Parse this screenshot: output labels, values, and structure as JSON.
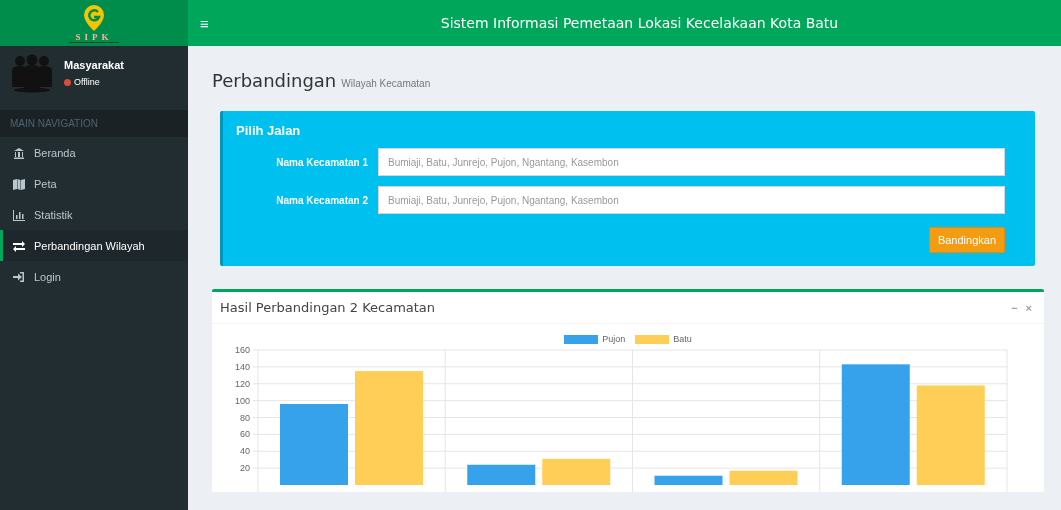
{
  "header": {
    "logo_text": "SIPK",
    "menu_icon": "≡",
    "app_title": "Sistem Informasi Pemetaan Lokasi Kecelakaan Kota Batu"
  },
  "sidebar": {
    "user": {
      "name": "Masyarakat",
      "status": "Offline",
      "online": false
    },
    "section_label": "MAIN NAVIGATION",
    "items": [
      {
        "label": "Beranda",
        "selected": false
      },
      {
        "label": "Peta",
        "selected": false
      },
      {
        "label": "Statistik",
        "selected": false
      },
      {
        "label": "Perbandingan Wilayah",
        "selected": true
      },
      {
        "label": "Login",
        "selected": false
      }
    ]
  },
  "page": {
    "title": "Perbandingan",
    "subtitle": "Wilayah Kecamatan"
  },
  "form": {
    "title": "Pilih Jalan",
    "fields": [
      {
        "label": "Nama Kecamatan 1",
        "placeholder": "Bumiaji, Batu, Junrejo, Pujon, Ngantang, Kasembon"
      },
      {
        "label": "Nama Kecamatan 2",
        "placeholder": "Bumiaji, Batu, Junrejo, Pujon, Ngantang, Kasembon"
      }
    ],
    "button": "Bandingkan"
  },
  "result": {
    "title": "Hasil Perbandingan 2 Kecamatan",
    "tools": [
      "−",
      "×"
    ],
    "chart_data": {
      "type": "bar",
      "grid": true,
      "legend": true,
      "ylim": [
        0,
        160
      ],
      "yticks": [
        20,
        40,
        60,
        80,
        100,
        120,
        140,
        160
      ],
      "series": [
        {
          "name": "Pujon",
          "color": "#36a2eb",
          "values": [
            96,
            24,
            11,
            143
          ]
        },
        {
          "name": "Batu",
          "color": "#ffce56",
          "values": [
            135,
            31,
            17,
            118
          ]
        }
      ]
    }
  }
}
